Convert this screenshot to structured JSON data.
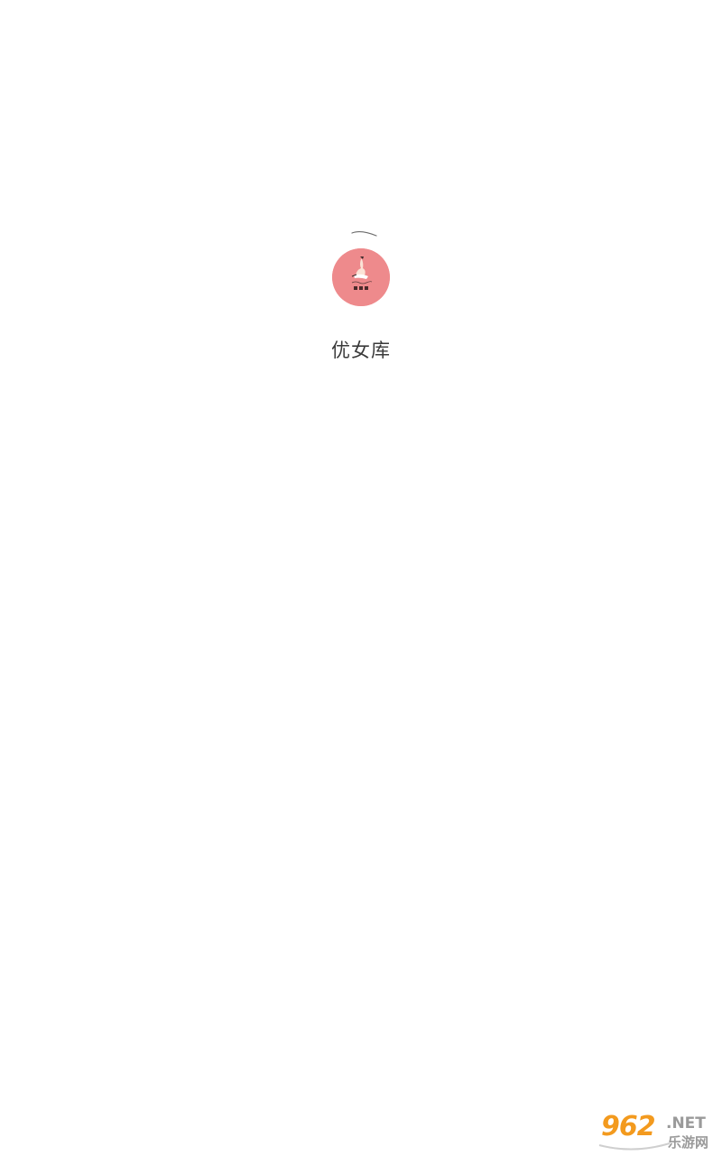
{
  "app": {
    "name": "优女库",
    "logo_icon": "app-logo-icon",
    "logo_color": "#ee8a8c"
  },
  "loading": {
    "icon": "loading-spinner-icon"
  },
  "watermark": {
    "number": "962",
    "domain": ".NET",
    "site_name": "乐游网"
  }
}
